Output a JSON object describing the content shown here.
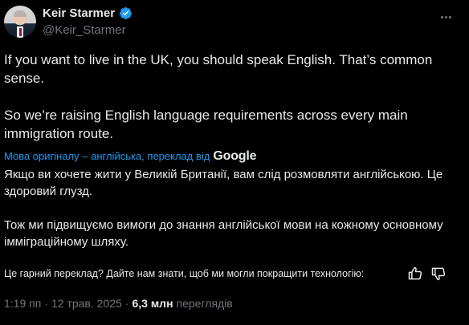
{
  "author": {
    "name": "Keir Starmer",
    "handle": "@Keir_Starmer",
    "verified_icon": "verified-badge-icon"
  },
  "tweet": {
    "paragraphs": [
      "If you want to live in the UK, you should speak English. That’s common sense.",
      "So we’re raising English language requirements across every main immigration route."
    ]
  },
  "translation": {
    "label": "Мова оригіналу – англійська, переклад від",
    "provider": "Google",
    "paragraphs": [
      "Якщо ви хочете жити у Великій Британії, вам слід розмовляти англійською. Це здоровий глузд.",
      "Тож ми підвищуємо вимоги до знання англійської мови на кожному основному імміграційному шляху."
    ],
    "feedback_prompt": "Це гарний переклад? Дайте нам знати, щоб ми могли покращити технологію:"
  },
  "meta": {
    "time": "1:19 пп",
    "separator": "·",
    "date": "12 трав. 2025",
    "separator2": "·",
    "views_count": "6,3 млн",
    "views_label": "переглядів"
  },
  "colors": {
    "background": "#000000",
    "text": "#e7e9ea",
    "muted": "#71767b",
    "link": "#1d9bf0",
    "verified": "#1d9bf0"
  }
}
